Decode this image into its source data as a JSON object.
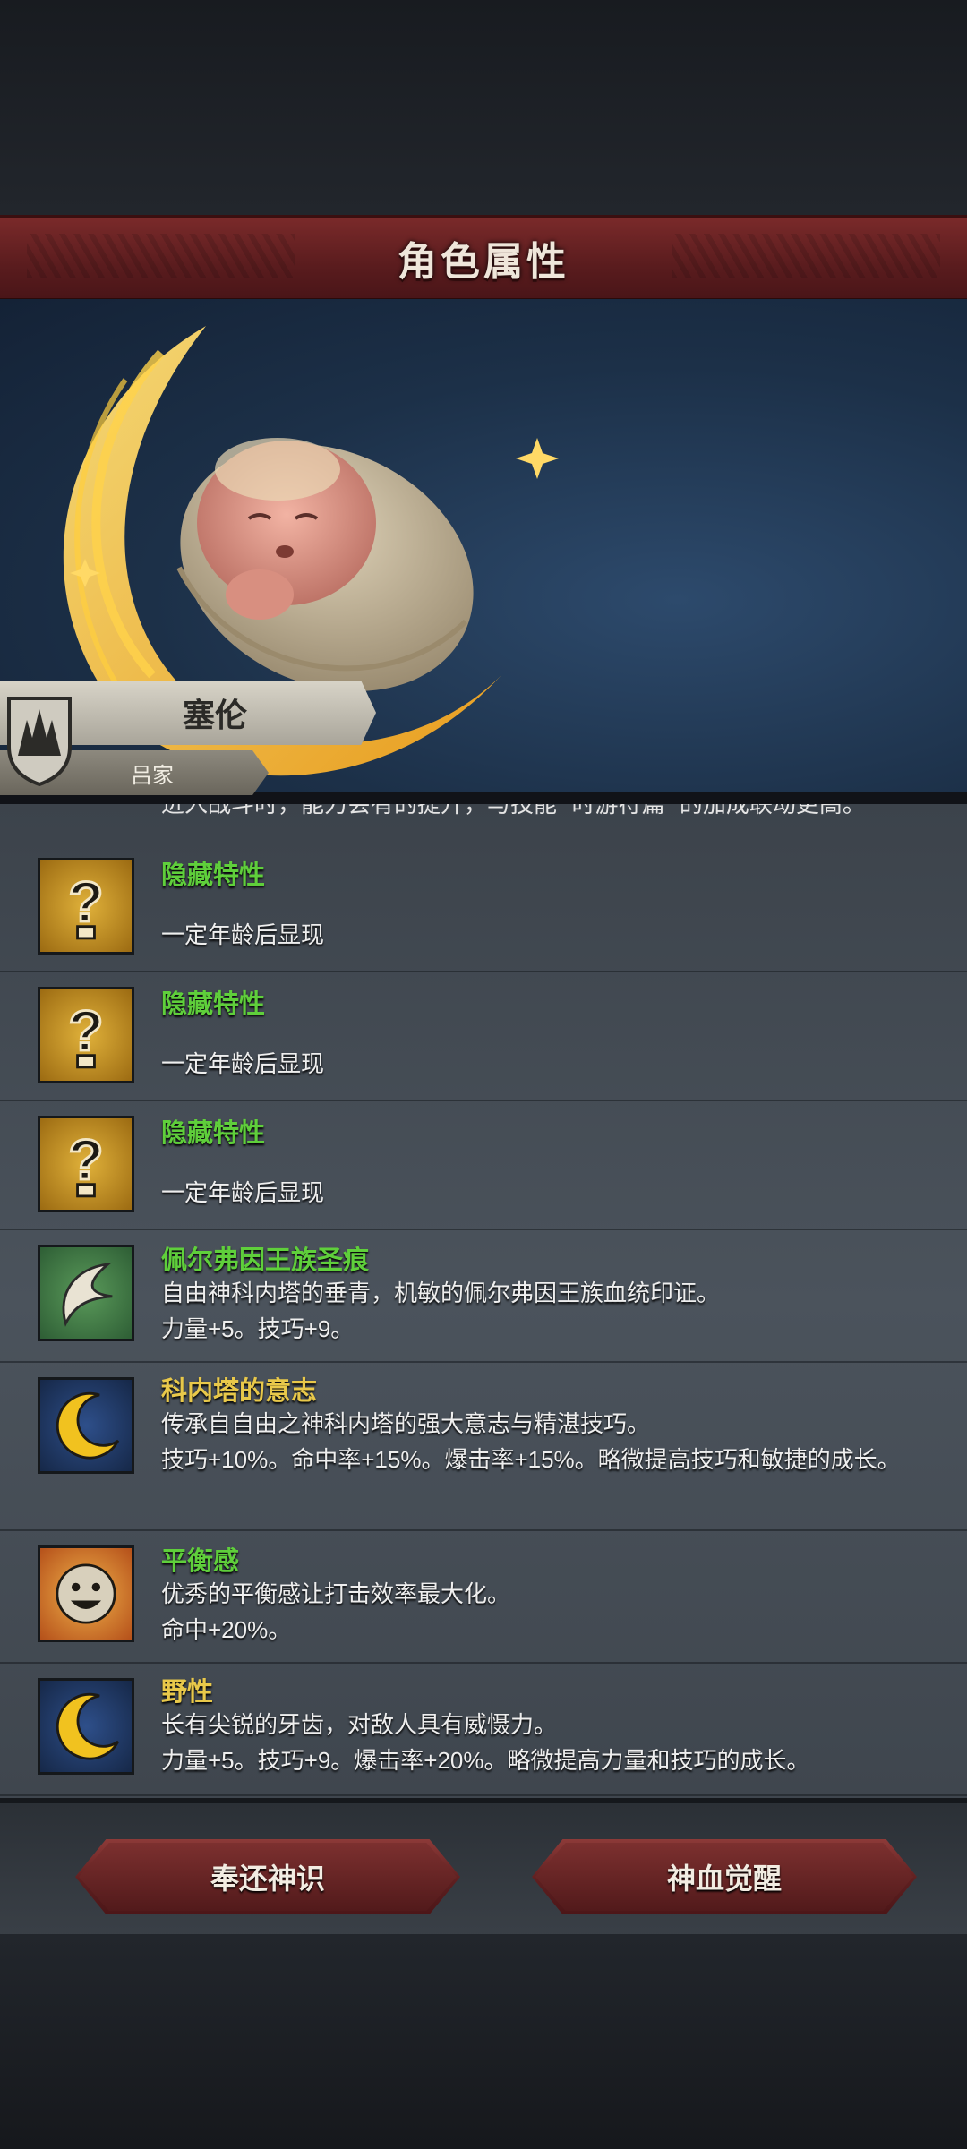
{
  "header": {
    "title": "角色属性"
  },
  "character": {
    "name": "塞伦",
    "family": "吕家"
  },
  "traits_clipped_line": "进入战斗时，能力会有的提升，与技能 \"时游符篇\" 的加成联动更高。",
  "traits": [
    {
      "name": "隐藏特性",
      "name_color": "green",
      "icon": "question-mark-icon",
      "desc": "一定年龄后显现"
    },
    {
      "name": "隐藏特性",
      "name_color": "green",
      "icon": "question-mark-icon",
      "desc": "一定年龄后显现"
    },
    {
      "name": "隐藏特性",
      "name_color": "green",
      "icon": "question-mark-icon",
      "desc": "一定年龄后显现"
    },
    {
      "name": "佩尔弗因王族圣痕",
      "name_color": "green",
      "icon": "royal-stigma-icon",
      "desc": "自由神科内塔的垂青，机敏的佩尔弗因王族血统印证。\n力量+5。技巧+9。"
    },
    {
      "name": "科内塔的意志",
      "name_color": "yellow",
      "icon": "crescent-moon-icon",
      "desc": "传承自自由之神科内塔的强大意志与精湛技巧。\n技巧+10%。命中率+15%。爆击率+15%。略微提高技巧和敏捷的成长。"
    },
    {
      "name": "平衡感",
      "name_color": "green",
      "icon": "smile-face-icon",
      "desc": "优秀的平衡感让打击效率最大化。\n命中+20%。"
    },
    {
      "name": "野性",
      "name_color": "yellow",
      "icon": "crescent-moon-icon",
      "desc": "长有尖锐的牙齿，对敌人具有威慑力。\n力量+5。技巧+9。爆击率+20%。略微提高力量和技巧的成长。"
    }
  ],
  "buttons": {
    "left": "奉还神识",
    "right": "神血觉醒"
  }
}
